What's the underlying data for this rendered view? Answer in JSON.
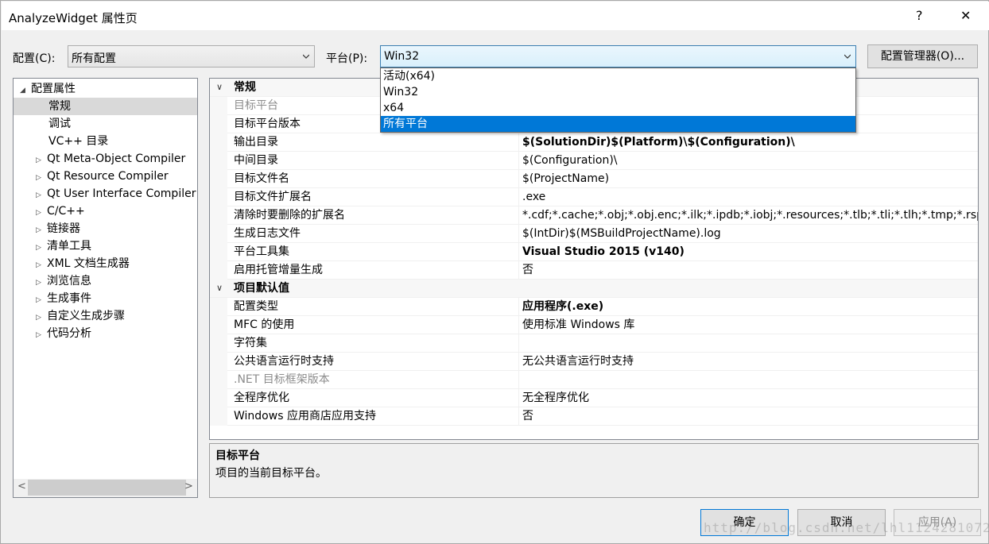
{
  "window": {
    "title": "AnalyzeWidget 属性页",
    "help_glyph": "?",
    "close_glyph": "✕"
  },
  "config_bar": {
    "config_label": "配置(C):",
    "config_value": "所有配置",
    "platform_label": "平台(P):",
    "platform_value": "Win32",
    "manager_button": "配置管理器(O)..."
  },
  "platform_dropdown": {
    "options": [
      "活动(x64)",
      "Win32",
      "x64",
      "所有平台"
    ],
    "selected_index": 3
  },
  "tree": {
    "items": [
      {
        "label": "配置属性",
        "expander": "◢"
      },
      {
        "label": "常规",
        "expander": ""
      },
      {
        "label": "调试",
        "expander": ""
      },
      {
        "label": "VC++ 目录",
        "expander": ""
      },
      {
        "label": "Qt Meta-Object Compiler",
        "expander": "▷"
      },
      {
        "label": "Qt Resource Compiler",
        "expander": "▷"
      },
      {
        "label": "Qt User Interface Compiler",
        "expander": "▷"
      },
      {
        "label": "C/C++",
        "expander": "▷"
      },
      {
        "label": "链接器",
        "expander": "▷"
      },
      {
        "label": "清单工具",
        "expander": "▷"
      },
      {
        "label": "XML 文档生成器",
        "expander": "▷"
      },
      {
        "label": "浏览信息",
        "expander": "▷"
      },
      {
        "label": "生成事件",
        "expander": "▷"
      },
      {
        "label": "自定义生成步骤",
        "expander": "▷"
      },
      {
        "label": "代码分析",
        "expander": "▷"
      }
    ],
    "selected": "常规",
    "scroll_left": "<",
    "scroll_right": ">"
  },
  "grid": {
    "rows": [
      {
        "type": "cat",
        "chevron": "∨",
        "name": "常规"
      },
      {
        "name": "目标平台",
        "value": "",
        "disabled": true
      },
      {
        "name": "目标平台版本",
        "value": ""
      },
      {
        "name": "输出目录",
        "value": "$(SolutionDir)$(Platform)\\$(Configuration)\\",
        "bold": true
      },
      {
        "name": "中间目录",
        "value": "$(Configuration)\\"
      },
      {
        "name": "目标文件名",
        "value": "$(ProjectName)"
      },
      {
        "name": "目标文件扩展名",
        "value": ".exe"
      },
      {
        "name": "清除时要删除的扩展名",
        "value": "*.cdf;*.cache;*.obj;*.obj.enc;*.ilk;*.ipdb;*.iobj;*.resources;*.tlb;*.tli;*.tlh;*.tmp;*.rsp;*.pgc;*.pgd"
      },
      {
        "name": "生成日志文件",
        "value": "$(IntDir)$(MSBuildProjectName).log"
      },
      {
        "name": "平台工具集",
        "value": "Visual Studio 2015 (v140)",
        "bold": true
      },
      {
        "name": "启用托管增量生成",
        "value": "否"
      },
      {
        "type": "cat",
        "chevron": "∨",
        "name": "项目默认值"
      },
      {
        "name": "配置类型",
        "value": "应用程序(.exe)",
        "bold": true
      },
      {
        "name": "MFC 的使用",
        "value": "使用标准 Windows 库"
      },
      {
        "name": "字符集",
        "value": ""
      },
      {
        "name": "公共语言运行时支持",
        "value": "无公共语言运行时支持"
      },
      {
        "name": ".NET 目标框架版本",
        "value": "",
        "disabled": true
      },
      {
        "name": "全程序优化",
        "value": "无全程序优化"
      },
      {
        "name": "Windows 应用商店应用支持",
        "value": "否"
      }
    ]
  },
  "description": {
    "title": "目标平台",
    "text": "项目的当前目标平台。"
  },
  "footer": {
    "ok": "确定",
    "cancel": "取消",
    "apply": "应用(A)",
    "watermark": "http://blog.csdn.net/lhl1124281072"
  }
}
